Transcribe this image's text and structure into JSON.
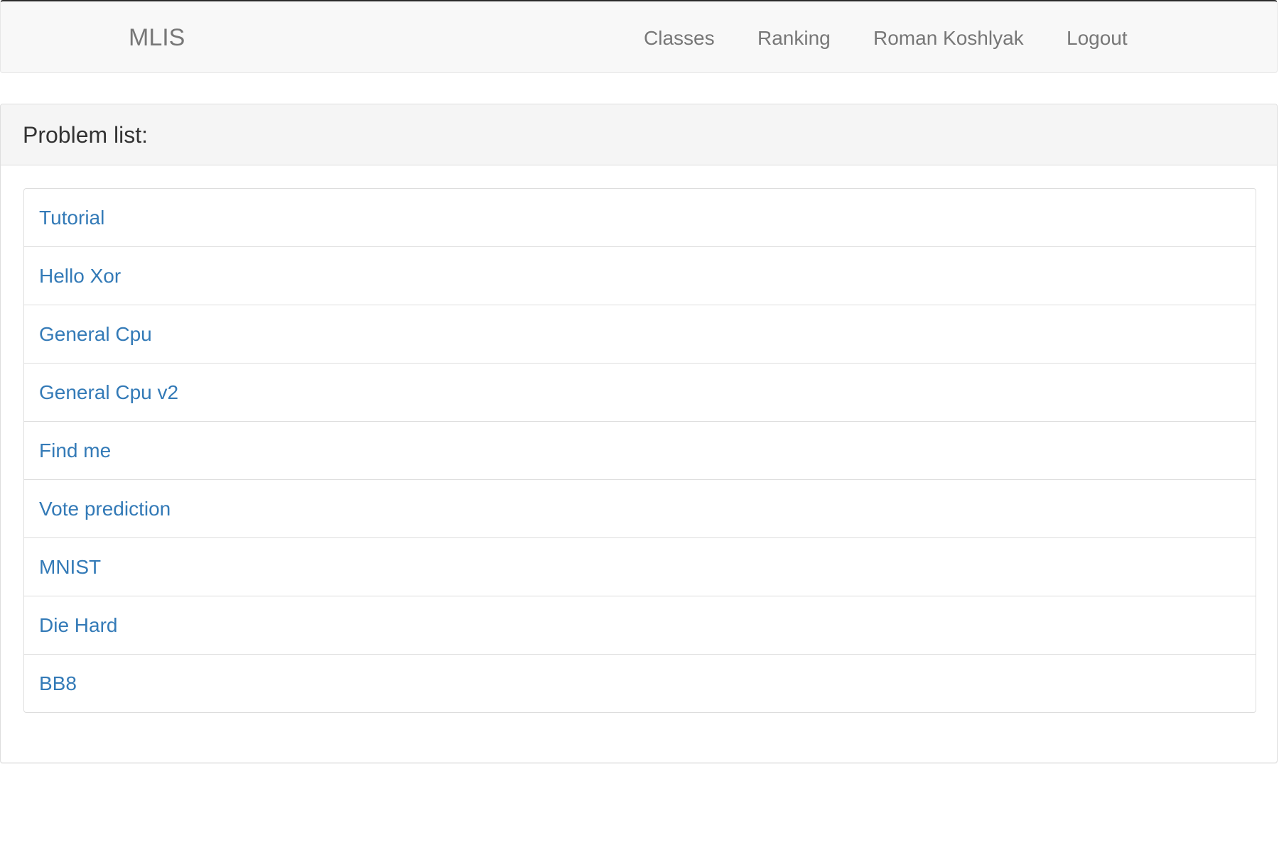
{
  "navbar": {
    "brand": "MLIS",
    "links": {
      "classes": "Classes",
      "ranking": "Ranking",
      "user": "Roman Koshlyak",
      "logout": "Logout"
    }
  },
  "panel": {
    "title": "Problem list:",
    "problems": [
      "Tutorial",
      "Hello Xor",
      "General Cpu",
      "General Cpu v2",
      "Find me",
      "Vote prediction",
      "MNIST",
      "Die Hard",
      "BB8"
    ]
  },
  "colors": {
    "link": "#337ab7",
    "navbar_bg": "#f8f8f8",
    "nav_text": "#777777",
    "panel_heading_bg": "#f5f5f5",
    "border": "#dddddd"
  }
}
